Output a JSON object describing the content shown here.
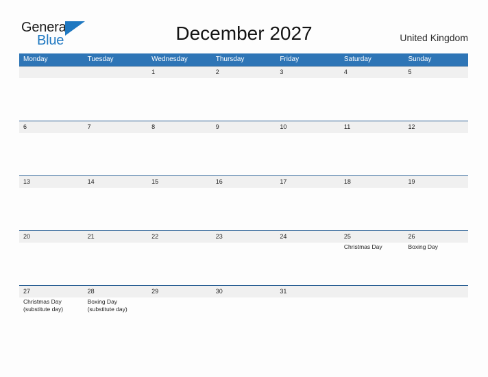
{
  "branding": {
    "logo_text_primary": "General",
    "logo_text_secondary": "Blue",
    "flag_icon": "blue-triangle-flag-icon",
    "primary_color": "#1f78c1",
    "header_color": "#2e75b6"
  },
  "header": {
    "title": "December 2027",
    "country": "United Kingdom"
  },
  "calendar": {
    "weekdays": [
      "Monday",
      "Tuesday",
      "Wednesday",
      "Thursday",
      "Friday",
      "Saturday",
      "Sunday"
    ],
    "weeks": [
      {
        "days": [
          {
            "num": "",
            "events": []
          },
          {
            "num": "",
            "events": []
          },
          {
            "num": "1",
            "events": []
          },
          {
            "num": "2",
            "events": []
          },
          {
            "num": "3",
            "events": []
          },
          {
            "num": "4",
            "events": []
          },
          {
            "num": "5",
            "events": []
          }
        ]
      },
      {
        "days": [
          {
            "num": "6",
            "events": []
          },
          {
            "num": "7",
            "events": []
          },
          {
            "num": "8",
            "events": []
          },
          {
            "num": "9",
            "events": []
          },
          {
            "num": "10",
            "events": []
          },
          {
            "num": "11",
            "events": []
          },
          {
            "num": "12",
            "events": []
          }
        ]
      },
      {
        "days": [
          {
            "num": "13",
            "events": []
          },
          {
            "num": "14",
            "events": []
          },
          {
            "num": "15",
            "events": []
          },
          {
            "num": "16",
            "events": []
          },
          {
            "num": "17",
            "events": []
          },
          {
            "num": "18",
            "events": []
          },
          {
            "num": "19",
            "events": []
          }
        ]
      },
      {
        "days": [
          {
            "num": "20",
            "events": []
          },
          {
            "num": "21",
            "events": []
          },
          {
            "num": "22",
            "events": []
          },
          {
            "num": "23",
            "events": []
          },
          {
            "num": "24",
            "events": []
          },
          {
            "num": "25",
            "events": [
              "Christmas Day"
            ]
          },
          {
            "num": "26",
            "events": [
              "Boxing Day"
            ]
          }
        ]
      },
      {
        "days": [
          {
            "num": "27",
            "events": [
              "Christmas Day",
              "(substitute day)"
            ]
          },
          {
            "num": "28",
            "events": [
              "Boxing Day",
              "(substitute day)"
            ]
          },
          {
            "num": "29",
            "events": []
          },
          {
            "num": "30",
            "events": []
          },
          {
            "num": "31",
            "events": []
          },
          {
            "num": "",
            "events": []
          },
          {
            "num": "",
            "events": []
          }
        ]
      }
    ]
  }
}
